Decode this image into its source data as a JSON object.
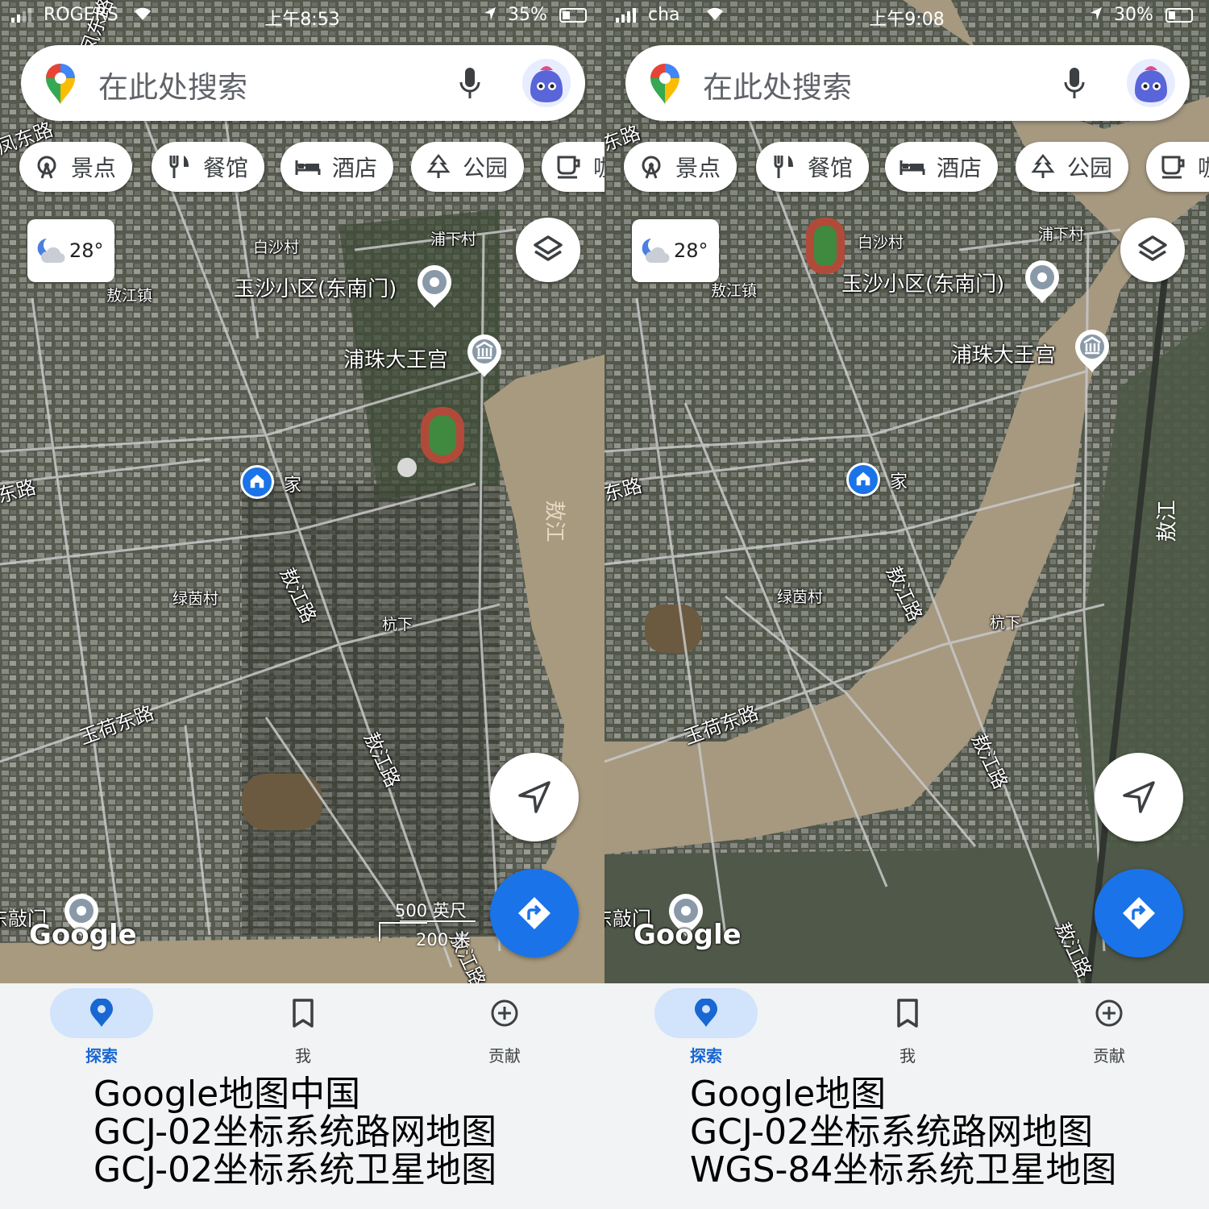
{
  "panels": [
    {
      "status": {
        "carrier": "ROGERS",
        "time": "上午8:53",
        "battery": "35%",
        "battery_level": 0.35
      },
      "search": {
        "placeholder": "在此处搜索"
      },
      "chips": [
        "景点",
        "餐馆",
        "酒店",
        "公园",
        "咖"
      ],
      "weather": {
        "temp": "28°"
      },
      "labels": {
        "baisha": "白沙村",
        "puxia": "浦下村",
        "aojiang_town": "敖江镇",
        "yusha": "玉沙小区(东南门)",
        "puzhu": "浦珠大王宫",
        "home": "家",
        "lvyin": "绿茵村",
        "hangxia": "杭下",
        "yuhe": "玉荷东路",
        "aojiang_road": "敖江路",
        "river": "敖江",
        "dong_road": "东路",
        "dongmen": "东敲门",
        "fengdong": "凤东路"
      },
      "google_logo": "Google",
      "scale": {
        "imperial": "500 英尺",
        "metric": "200 米"
      },
      "tabs": [
        {
          "label": "探索"
        },
        {
          "label": "我"
        },
        {
          "label": "贡献"
        }
      ],
      "caption": [
        "Google地图中国",
        "GCJ-02坐标系统路网地图",
        "GCJ-02坐标系统卫星地图"
      ]
    },
    {
      "status": {
        "carrier": "cha",
        "time": "上午9:08",
        "battery": "30%",
        "battery_level": 0.3
      },
      "search": {
        "placeholder": "在此处搜索"
      },
      "chips": [
        "景点",
        "餐馆",
        "酒店",
        "公园",
        "咖"
      ],
      "weather": {
        "temp": "28°"
      },
      "labels": {
        "baisha": "白沙村",
        "puxia": "浦下村",
        "aojiang_town": "敖江镇",
        "yusha": "玉沙小区(东南门)",
        "puzhu": "浦珠大王宫",
        "home": "家",
        "lvyin": "绿茵村",
        "hangxia": "杭下",
        "yuhe": "玉荷东路",
        "aojiang_road": "敖江路",
        "river": "敖江",
        "dong_road": "东路",
        "dongmen": "东敲门",
        "fengdong": "东路"
      },
      "google_logo": "Google",
      "tabs": [
        {
          "label": "探索"
        },
        {
          "label": "我"
        },
        {
          "label": "贡献"
        }
      ],
      "caption": [
        "Google地图",
        "GCJ-02坐标系统路网地图",
        "WGS-84坐标系统卫星地图"
      ]
    }
  ],
  "icons": {
    "chips": [
      "ferris-wheel-icon",
      "restaurant-icon",
      "hotel-bed-icon",
      "park-tree-icon",
      "coffee-cup-icon"
    ],
    "tabs": [
      "explore-pin-icon",
      "saved-bookmark-icon",
      "contribute-plus-icon"
    ]
  },
  "colors": {
    "accent": "#1a73e8",
    "active_tab_bg": "#d2e3fc",
    "river": "#a89a7e"
  }
}
